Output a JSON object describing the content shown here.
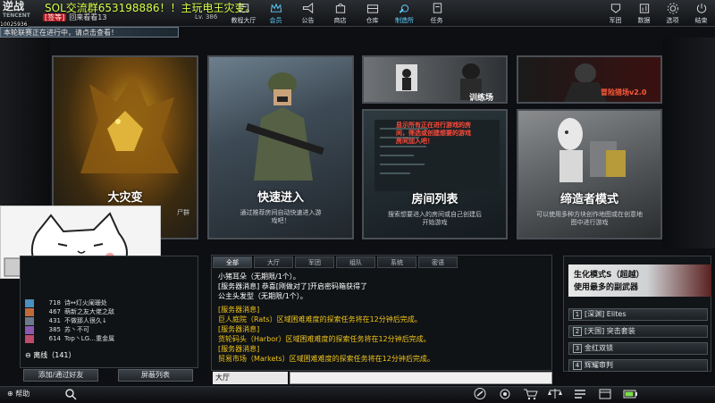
{
  "header": {
    "logo_line1": "逆战",
    "logo_line2": "TENCENT",
    "stream_title": "SOL交流群653198886！！主玩电王灾变。",
    "player_tag": "[签等]",
    "player_name": "回来看看13",
    "level": "Lv. 386",
    "id_text": "10025936"
  },
  "nav": [
    {
      "label": "教程大厅",
      "icon": "tutorial-icon"
    },
    {
      "label": "会员",
      "icon": "crown-icon"
    },
    {
      "label": "公告",
      "icon": "megaphone-icon"
    },
    {
      "label": "商店",
      "icon": "shop-icon"
    },
    {
      "label": "仓库",
      "icon": "warehouse-icon"
    },
    {
      "label": "制造所",
      "icon": "craft-icon"
    },
    {
      "label": "任务",
      "icon": "task-icon"
    },
    {
      "label": "军团",
      "icon": "legion-icon"
    },
    {
      "label": "数据",
      "icon": "data-icon"
    },
    {
      "label": "选项",
      "icon": "gear-icon"
    },
    {
      "label": "结束",
      "icon": "power-icon"
    }
  ],
  "notice": "本轮联赛正在进行中，请点击查看！",
  "modes": {
    "card1": {
      "title": "大灾变",
      "desc": "尸群"
    },
    "card2": {
      "title": "快速进入",
      "desc": "通过推荐房间自动快速进入游戏吧！"
    },
    "card3": {
      "title": "房间列表",
      "desc": "搜索想要进入的房间或自己创建后开始游戏",
      "board": "显示所有正在进行游戏的房间，筛选或创建想要的游戏房间加入吧！"
    },
    "card4": {
      "title": "缔造者模式",
      "desc": "可以使用多种方块创作地图或在创意地图中进行游戏"
    },
    "card5": {
      "title": "训练场"
    },
    "card6": {
      "title": "冒险猎场v2.0"
    }
  },
  "chat": {
    "tabs": [
      "全部",
      "大厅",
      "军团",
      "组队",
      "系统",
      "密语"
    ],
    "lines": [
      {
        "text": "小猪耳朵（无期限/1个）。",
        "color": "#ffffff"
      },
      {
        "text": "[服务器消息] 恭喜[刚做对了]开启密码箱获得了",
        "color": "#ffffff"
      },
      {
        "text": "公主头发型（无期限/1个）。",
        "color": "#ffffff"
      },
      {
        "text": "[服务器消息]",
        "color": "#f0c419"
      },
      {
        "text": "巨人庭院（Rats）区域困难难度的探索任务将在12分钟后完成。",
        "color": "#f0c419"
      },
      {
        "text": "[服务器消息]",
        "color": "#f0c419"
      },
      {
        "text": "货轮码头（Harbor）区域困难难度的探索任务将在12分钟后完成。",
        "color": "#f0c419"
      },
      {
        "text": "[服务器消息]",
        "color": "#f0c419"
      },
      {
        "text": "贸易市场（Markets）区域困难难度的探索任务将在12分钟后完成。",
        "color": "#f0c419"
      }
    ],
    "channel": "大厅"
  },
  "friends": {
    "rows": [
      {
        "level": "718",
        "name": "诗↔灯火阑珊处"
      },
      {
        "level": "467",
        "name": "萌新之友大佬之敌"
      },
      {
        "level": "431",
        "name": "不做那人很久↓"
      },
      {
        "level": "385",
        "name": "苏丶不可"
      },
      {
        "level": "614",
        "name": "Top丶LG…重金属"
      }
    ],
    "offline": "离线（141）",
    "add_button": "添加/通过好友",
    "block_button": "屏蔽列表"
  },
  "right_panel": {
    "promo_line1": "生化模式S（超越）",
    "promo_line2": "使用最多的副武器",
    "buttons": [
      {
        "num": "1",
        "label": "[深渊] Elites"
      },
      {
        "num": "2",
        "label": "[天国] 突击套装"
      },
      {
        "num": "3",
        "label": "金红双锁"
      },
      {
        "num": "4",
        "label": "辉耀审判"
      }
    ]
  },
  "footer": {
    "help": "帮助"
  }
}
